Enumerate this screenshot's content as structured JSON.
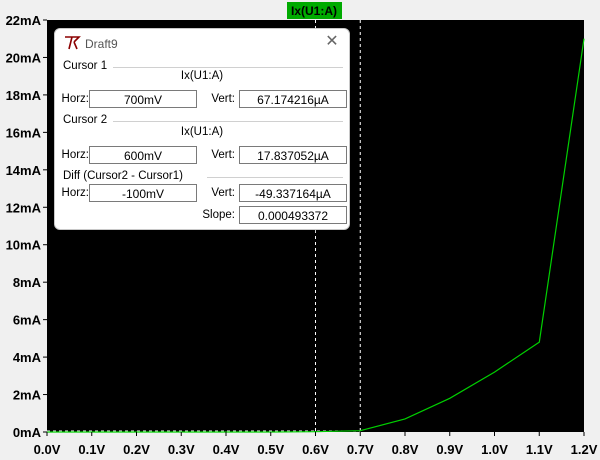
{
  "trace_label": "Ix(U1:A)",
  "colors": {
    "plot_bg": "#000000",
    "trace": "#00d000",
    "grid_line": "#ffffff",
    "label_bg": "#00aa00"
  },
  "chart_data": {
    "type": "line",
    "xlabel": "",
    "ylabel": "",
    "xlim": [
      0.0,
      1.2
    ],
    "ylim": [
      0,
      22
    ],
    "x_ticks": [
      "0.0V",
      "0.1V",
      "0.2V",
      "0.3V",
      "0.4V",
      "0.5V",
      "0.6V",
      "0.7V",
      "0.8V",
      "0.9V",
      "1.0V",
      "1.1V",
      "1.2V"
    ],
    "y_ticks": [
      "0mA",
      "2mA",
      "4mA",
      "6mA",
      "8mA",
      "10mA",
      "12mA",
      "14mA",
      "16mA",
      "18mA",
      "20mA",
      "22mA"
    ],
    "series": [
      {
        "name": "Ix(U1:A)",
        "x": [
          0.0,
          0.5,
          0.6,
          0.7,
          0.8,
          0.9,
          1.0,
          1.1,
          1.2
        ],
        "y": [
          0.0,
          0.0,
          0.0178,
          0.0672,
          0.7,
          1.8,
          3.2,
          4.8,
          21.0
        ]
      }
    ],
    "cursors": [
      0.7,
      0.6
    ]
  },
  "dialog": {
    "title": "Draft9",
    "close_icon": "close-icon",
    "cursor1": {
      "title": "Cursor 1",
      "trace": "Ix(U1:A)",
      "horz_label": "Horz:",
      "horz": "700mV",
      "vert_label": "Vert:",
      "vert": "67.174216µA"
    },
    "cursor2": {
      "title": "Cursor 2",
      "trace": "Ix(U1:A)",
      "horz_label": "Horz:",
      "horz": "600mV",
      "vert_label": "Vert:",
      "vert": "17.837052µA"
    },
    "diff": {
      "title": "Diff (Cursor2 - Cursor1)",
      "horz_label": "Horz:",
      "horz": "-100mV",
      "vert_label": "Vert:",
      "vert": "-49.337164µA",
      "slope_label": "Slope:",
      "slope": "0.000493372"
    }
  }
}
